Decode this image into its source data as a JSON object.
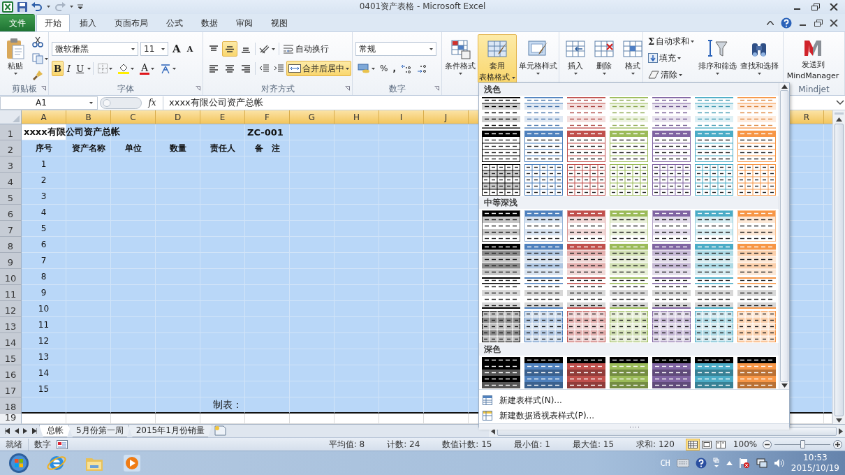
{
  "window": {
    "title": "0401资产表格 - Microsoft Excel"
  },
  "ribbon_tabs": [
    {
      "label": "文件",
      "kind": "file",
      "selected": false
    },
    {
      "label": "开始",
      "kind": "tab",
      "selected": true
    },
    {
      "label": "插入",
      "kind": "tab",
      "selected": false
    },
    {
      "label": "页面布局",
      "kind": "tab",
      "selected": false
    },
    {
      "label": "公式",
      "kind": "tab",
      "selected": false
    },
    {
      "label": "数据",
      "kind": "tab",
      "selected": false
    },
    {
      "label": "审阅",
      "kind": "tab",
      "selected": false
    },
    {
      "label": "视图",
      "kind": "tab",
      "selected": false
    }
  ],
  "clipboard": {
    "label": "剪贴板",
    "paste": "粘贴"
  },
  "font": {
    "label": "字体",
    "name": "微软雅黑",
    "size": "11",
    "grow": "A",
    "shrink": "A",
    "bold": {
      "text": "B",
      "on": true
    },
    "italic": {
      "text": "I",
      "on": false
    },
    "underline": {
      "text": "U",
      "on": false
    },
    "font_color": "A"
  },
  "alignment": {
    "label": "对齐方式",
    "vertical": [
      {
        "kind": "top",
        "selected": false
      },
      {
        "kind": "middle",
        "selected": true
      },
      {
        "kind": "bottom",
        "selected": false
      }
    ],
    "horizontal": [
      {
        "kind": "left",
        "selected": false
      },
      {
        "kind": "center",
        "selected": false
      },
      {
        "kind": "right",
        "selected": false
      }
    ],
    "wrap_text": {
      "text": "自动换行",
      "on": false
    },
    "merge_center": {
      "text": "合并后居中",
      "on": true
    }
  },
  "number": {
    "label": "数字",
    "format": "常规",
    "percent": "%",
    "comma": ","
  },
  "styles": {
    "conditional": "条件格式",
    "table_format": {
      "lines": [
        "套用",
        "表格格式"
      ],
      "open": true
    },
    "cell_styles": "单元格样式"
  },
  "cells": [
    {
      "kind": "insert",
      "label": "插入"
    },
    {
      "kind": "delete",
      "label": "删除"
    },
    {
      "kind": "format",
      "label": "格式"
    }
  ],
  "editing": {
    "autosum": {
      "symbol": "Σ",
      "label": "自动求和"
    },
    "fill": "填充",
    "clear": "清除",
    "sort": "排序和筛选",
    "find": "查找和选择"
  },
  "mindjet": {
    "label": "Mindjet",
    "button": [
      "发送到",
      "MindManager"
    ]
  },
  "formula_bar": {
    "name_box": "A1",
    "fx": "fx",
    "formula": "xxxx有限公司资产总帐"
  },
  "sheet": {
    "columns": [
      "A",
      "B",
      "C",
      "D",
      "E",
      "F",
      "G",
      "H",
      "I",
      "J"
    ],
    "far_columns": [
      "R"
    ],
    "rows": [
      {
        "number": "1",
        "kind": "title",
        "selected": true,
        "cells": [
          {
            "text": "xxxx有限公司资产总帐",
            "active": true
          },
          null,
          null,
          null,
          null,
          {
            "text": "ZC-001",
            "active": false
          },
          null,
          null,
          null,
          null
        ]
      },
      {
        "number": "2",
        "kind": "header",
        "selected": true,
        "cells": [
          {
            "text": "序号",
            "active": false
          },
          {
            "text": "资产名称",
            "active": false
          },
          {
            "text": "单位",
            "active": false
          },
          {
            "text": "数量",
            "active": false
          },
          {
            "text": "责任人",
            "active": false
          },
          {
            "text": "备　注",
            "active": false
          },
          null,
          null,
          null,
          null
        ]
      },
      {
        "number": "3",
        "kind": "data",
        "selected": true,
        "cells": [
          {
            "text": "1",
            "active": false
          },
          null,
          null,
          null,
          null,
          null,
          null,
          null,
          null,
          null
        ]
      },
      {
        "number": "4",
        "kind": "data",
        "selected": true,
        "cells": [
          {
            "text": "2",
            "active": false
          },
          null,
          null,
          null,
          null,
          null,
          null,
          null,
          null,
          null
        ]
      },
      {
        "number": "5",
        "kind": "data",
        "selected": true,
        "cells": [
          {
            "text": "3",
            "active": false
          },
          null,
          null,
          null,
          null,
          null,
          null,
          null,
          null,
          null
        ]
      },
      {
        "number": "6",
        "kind": "data",
        "selected": true,
        "cells": [
          {
            "text": "4",
            "active": false
          },
          null,
          null,
          null,
          null,
          null,
          null,
          null,
          null,
          null
        ]
      },
      {
        "number": "7",
        "kind": "data",
        "selected": true,
        "cells": [
          {
            "text": "5",
            "active": false
          },
          null,
          null,
          null,
          null,
          null,
          null,
          null,
          null,
          null
        ]
      },
      {
        "number": "8",
        "kind": "data",
        "selected": true,
        "cells": [
          {
            "text": "6",
            "active": false
          },
          null,
          null,
          null,
          null,
          null,
          null,
          null,
          null,
          null
        ]
      },
      {
        "number": "9",
        "kind": "data",
        "selected": true,
        "cells": [
          {
            "text": "7",
            "active": false
          },
          null,
          null,
          null,
          null,
          null,
          null,
          null,
          null,
          null
        ]
      },
      {
        "number": "10",
        "kind": "data",
        "selected": true,
        "cells": [
          {
            "text": "8",
            "active": false
          },
          null,
          null,
          null,
          null,
          null,
          null,
          null,
          null,
          null
        ]
      },
      {
        "number": "11",
        "kind": "data",
        "selected": true,
        "cells": [
          {
            "text": "9",
            "active": false
          },
          null,
          null,
          null,
          null,
          null,
          null,
          null,
          null,
          null
        ]
      },
      {
        "number": "12",
        "kind": "data",
        "selected": true,
        "cells": [
          {
            "text": "10",
            "active": false
          },
          null,
          null,
          null,
          null,
          null,
          null,
          null,
          null,
          null
        ]
      },
      {
        "number": "13",
        "kind": "data",
        "selected": true,
        "cells": [
          {
            "text": "11",
            "active": false
          },
          null,
          null,
          null,
          null,
          null,
          null,
          null,
          null,
          null
        ]
      },
      {
        "number": "14",
        "kind": "data",
        "selected": true,
        "cells": [
          {
            "text": "12",
            "active": false
          },
          null,
          null,
          null,
          null,
          null,
          null,
          null,
          null,
          null
        ]
      },
      {
        "number": "15",
        "kind": "data",
        "selected": true,
        "cells": [
          {
            "text": "13",
            "active": false
          },
          null,
          null,
          null,
          null,
          null,
          null,
          null,
          null,
          null
        ]
      },
      {
        "number": "16",
        "kind": "data",
        "selected": true,
        "cells": [
          {
            "text": "14",
            "active": false
          },
          null,
          null,
          null,
          null,
          null,
          null,
          null,
          null,
          null
        ]
      },
      {
        "number": "17",
        "kind": "data",
        "selected": true,
        "cells": [
          {
            "text": "15",
            "active": false
          },
          null,
          null,
          null,
          null,
          null,
          null,
          null,
          null,
          null
        ]
      },
      {
        "number": "18",
        "kind": "footer",
        "selected": true,
        "cells": [
          null,
          null,
          null,
          null,
          {
            "text": "制表：",
            "active": false
          },
          null,
          null,
          null,
          null,
          null
        ]
      },
      {
        "number": "19",
        "kind": "blank",
        "selected": false,
        "cells": [
          null,
          null,
          null,
          null,
          null,
          null,
          null,
          null,
          null,
          null
        ]
      }
    ]
  },
  "table_styles": {
    "swatch_colors": [
      {
        "color": "#000000"
      },
      {
        "color": "#4f81bd"
      },
      {
        "color": "#c0504d"
      },
      {
        "color": "#9bbb59"
      },
      {
        "color": "#8064a2"
      },
      {
        "color": "#4bacc6"
      },
      {
        "color": "#f79646"
      }
    ],
    "sections": [
      {
        "title": "浅色",
        "rows": [
          {
            "kind": "light-lines"
          },
          {
            "kind": "light-header"
          },
          {
            "kind": "light-grid"
          }
        ]
      },
      {
        "title": "中等深浅",
        "rows": [
          {
            "kind": "medium-header"
          },
          {
            "kind": "medium-banded"
          },
          {
            "kind": "medium-lines"
          },
          {
            "kind": "medium-grid"
          }
        ]
      },
      {
        "title": "深色",
        "rows": [
          {
            "kind": "dark"
          }
        ]
      }
    ],
    "commands": [
      {
        "kind": "table-style",
        "label": "新建表样式(N)..."
      },
      {
        "kind": "pivot-style",
        "label": "新建数据透视表样式(P)..."
      }
    ]
  },
  "sheet_tabs": [
    {
      "label": "总帐",
      "selected": true
    },
    {
      "label": "5月份第一周",
      "selected": false
    },
    {
      "label": "2015年1月份销量",
      "selected": false
    }
  ],
  "status_bar": {
    "mode": "就绪",
    "num_lock": "数字",
    "stats": [
      "平均值: 8",
      "计数: 24",
      "数值计数: 15",
      "最小值: 1",
      "最大值: 15",
      "求和: 120"
    ],
    "views": [
      {
        "kind": "normal",
        "selected": true
      },
      {
        "kind": "page-layout",
        "selected": false
      },
      {
        "kind": "page-break",
        "selected": false
      }
    ],
    "zoom": "100%",
    "zoom_slider": {
      "level": 0.5
    }
  },
  "taskbar": {
    "apps": [
      {
        "kind": "browser"
      },
      {
        "kind": "folder"
      },
      {
        "kind": "media"
      }
    ],
    "language": "CH",
    "time": "10:53",
    "date": "2015/10/19"
  }
}
